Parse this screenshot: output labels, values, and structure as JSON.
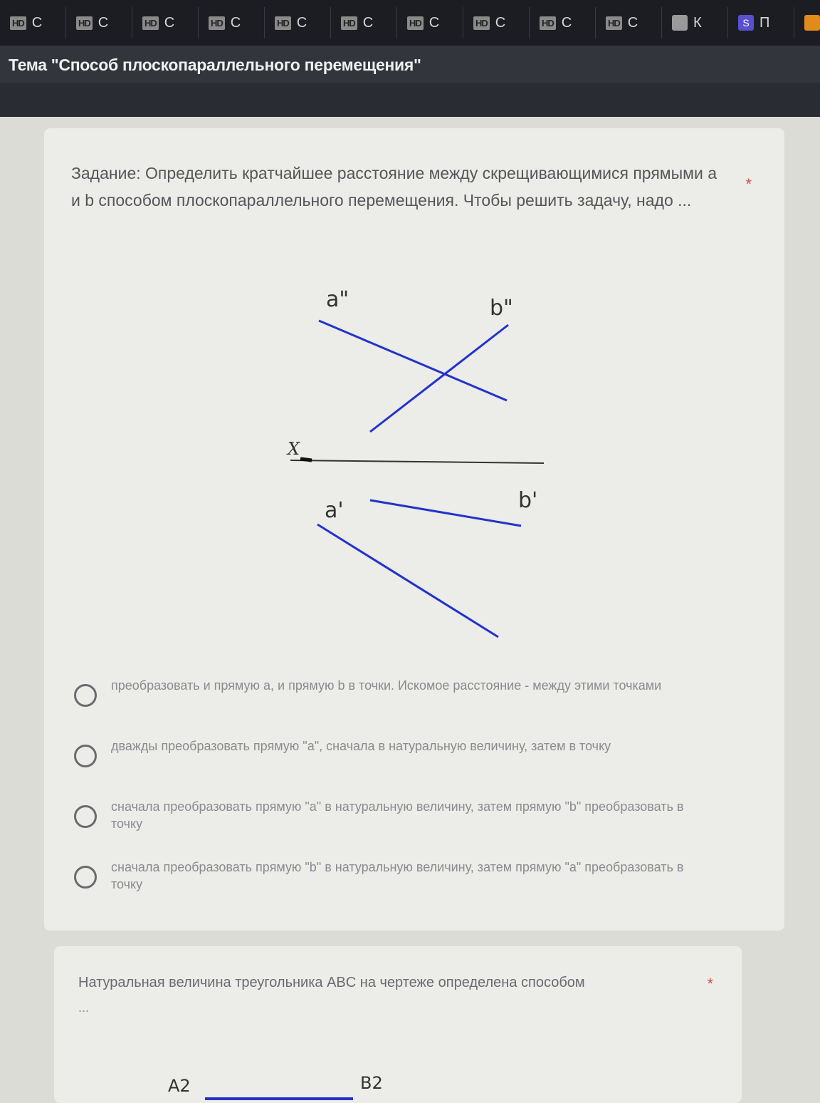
{
  "tabs": [
    {
      "badge": "HD",
      "label": "C"
    },
    {
      "badge": "HD",
      "label": "C"
    },
    {
      "badge": "HD",
      "label": "C"
    },
    {
      "badge": "HD",
      "label": "C"
    },
    {
      "badge": "HD",
      "label": "C"
    },
    {
      "badge": "HD",
      "label": "C"
    },
    {
      "badge": "HD",
      "label": "C"
    },
    {
      "badge": "HD",
      "label": "C"
    },
    {
      "badge": "HD",
      "label": "C"
    },
    {
      "badge": "HD",
      "label": "C"
    }
  ],
  "extra_tabs": [
    {
      "icon": "book-icon",
      "label": "К"
    },
    {
      "icon": "s-logo-icon",
      "label": "П"
    }
  ],
  "topic_title": "Тема \"Способ плоскопараллельного перемещения\"",
  "question1": {
    "text": "Задание: Определить кратчайшее расстояние между скрещивающимися прямыми a и b способом плоскопараллельного перемещения. Чтобы решить задачу, надо ...",
    "required_mark": "*",
    "diagram_labels": {
      "a_front": "a\"",
      "b_front": "b\"",
      "axis": "X",
      "a_top": "a'",
      "b_top": "b'"
    },
    "options": [
      "преобразовать и прямую а, и прямую b в точки. Искомое расстояние - между этими точками",
      "дважды преобразовать прямую \"а\", сначала в натуральную величину, затем в точку",
      "сначала преобразовать прямую \"а\" в натуральную величину, затем прямую \"b\" преобразовать в точку",
      "сначала преобразовать прямую \"b\" в натуральную величину, затем прямую \"а\" преобразовать в точку"
    ]
  },
  "question2": {
    "text": "Натуральная величина треугольника ABC на чертеже определена способом",
    "continuation": "...",
    "required_mark": "*",
    "diagram_labels": {
      "a2": "A2",
      "b2": "B2"
    }
  },
  "colors": {
    "line_blue": "#2233cc",
    "required": "#d0504a"
  }
}
